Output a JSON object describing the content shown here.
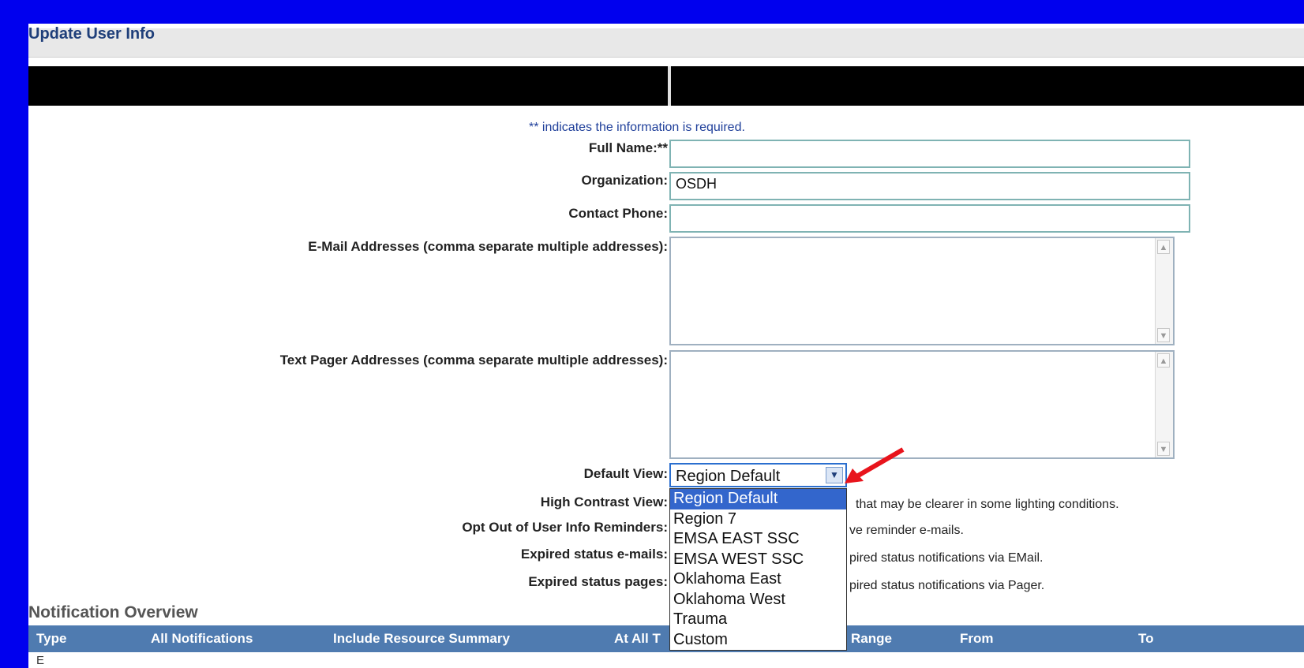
{
  "window": {
    "title": "Update User Info"
  },
  "form": {
    "required_note": "** indicates the information is required.",
    "full_name": {
      "label": "Full Name:**",
      "value": ""
    },
    "organization": {
      "label": "Organization:",
      "value": "OSDH"
    },
    "contact_phone": {
      "label": "Contact Phone:",
      "value": ""
    },
    "email_addresses": {
      "label": "E-Mail Addresses (comma separate multiple addresses):",
      "value": ""
    },
    "pager_addresses": {
      "label": "Text Pager Addresses (comma separate multiple addresses):",
      "value": ""
    },
    "default_view": {
      "label": "Default View:",
      "selected": "Region Default",
      "options": [
        "Region Default",
        "Region 7",
        "EMSA EAST SSC",
        "EMSA WEST SSC",
        "Oklahoma East",
        "Oklahoma West",
        "Trauma",
        "Custom"
      ]
    },
    "high_contrast_view": {
      "label": "High Contrast View:",
      "trailing_text": "that may be clearer in some lighting conditions."
    },
    "opt_out_reminders": {
      "label": "Opt Out of User Info Reminders:",
      "trailing_text": "ve reminder e-mails."
    },
    "expired_emails": {
      "label": "Expired status e-mails:",
      "trailing_text": "pired status notifications via EMail."
    },
    "expired_pages": {
      "label": "Expired status pages:",
      "trailing_text": "pired status notifications via Pager."
    }
  },
  "notification_overview": {
    "title": "Notification Overview",
    "columns": [
      "Type",
      "All Notifications",
      "Include Resource Summary",
      "At All T",
      "Range",
      "From",
      "To"
    ],
    "first_row_partial": "E"
  },
  "colors": {
    "frame_blue": "#0000ee",
    "title_text": "#1f3f7a",
    "header_blue": "#4f7bb0",
    "dropdown_highlight": "#3366cc",
    "annotation_arrow": "#e8141c"
  }
}
